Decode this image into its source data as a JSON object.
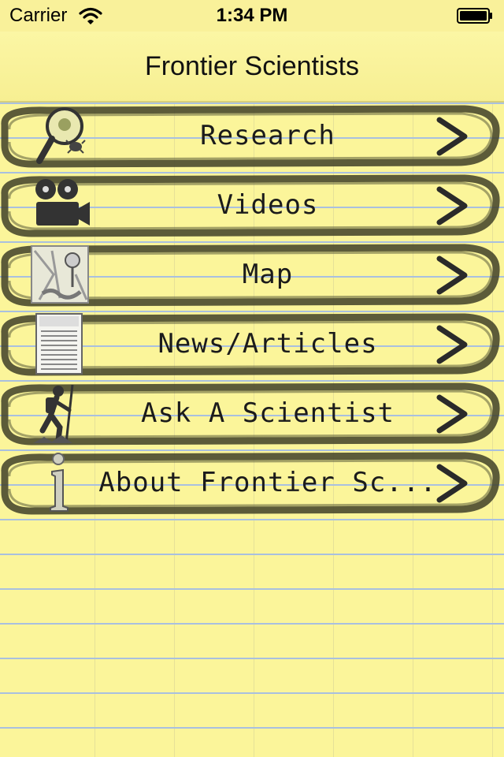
{
  "status_bar": {
    "carrier": "Carrier",
    "time": "1:34 PM",
    "wifi_icon": "wifi-icon",
    "battery_icon": "battery-icon"
  },
  "nav": {
    "title": "Frontier Scientists"
  },
  "menu": {
    "items": [
      {
        "label": "Research",
        "icon": "magnifier-bug-icon"
      },
      {
        "label": "Videos",
        "icon": "film-camera-icon"
      },
      {
        "label": "Map",
        "icon": "map-pin-icon"
      },
      {
        "label": "News/Articles",
        "icon": "articles-newspaper-icon"
      },
      {
        "label": "Ask A Scientist",
        "icon": "hiker-icon"
      },
      {
        "label": "About Frontier Sc...",
        "icon": "info-icon"
      }
    ],
    "chevron_icon": "chevron-right-icon"
  },
  "colors": {
    "paper": "#fbf59a",
    "rule_line": "#a9c0df",
    "scribble": "#4a4a2e",
    "text": "#1b1b1b"
  }
}
